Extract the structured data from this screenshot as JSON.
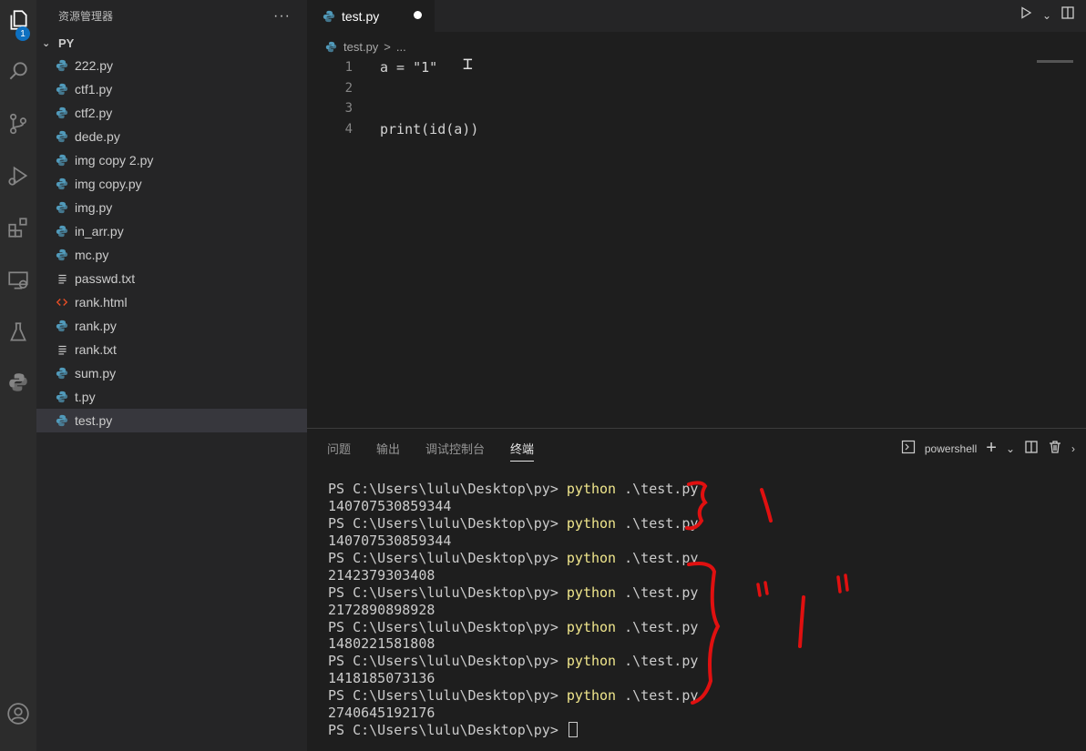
{
  "activity_bar": {
    "explorer_badge": "1",
    "icons": [
      "explorer-icon",
      "search-icon",
      "source-control-icon",
      "run-debug-icon",
      "extensions-icon",
      "remote-explorer-icon",
      "testing-icon",
      "python-icon",
      "account-icon"
    ]
  },
  "sidebar": {
    "title": "资源管理器",
    "more": "···",
    "folder": "PY",
    "files": [
      {
        "name": "222.py",
        "type": "py"
      },
      {
        "name": "ctf1.py",
        "type": "py"
      },
      {
        "name": "ctf2.py",
        "type": "py"
      },
      {
        "name": "dede.py",
        "type": "py"
      },
      {
        "name": "img copy 2.py",
        "type": "py"
      },
      {
        "name": "img copy.py",
        "type": "py"
      },
      {
        "name": "img.py",
        "type": "py"
      },
      {
        "name": "in_arr.py",
        "type": "py"
      },
      {
        "name": "mc.py",
        "type": "py"
      },
      {
        "name": "passwd.txt",
        "type": "txt"
      },
      {
        "name": "rank.html",
        "type": "html"
      },
      {
        "name": "rank.py",
        "type": "py"
      },
      {
        "name": "rank.txt",
        "type": "txt"
      },
      {
        "name": "sum.py",
        "type": "py"
      },
      {
        "name": "t.py",
        "type": "py"
      },
      {
        "name": "test.py",
        "type": "py",
        "active": true
      }
    ]
  },
  "editor": {
    "tab_label": "test.py",
    "breadcrumb_file": "test.py",
    "breadcrumb_sep": ">",
    "breadcrumb_more": "...",
    "lines": [
      {
        "num": "1",
        "text": "a = \"1\""
      },
      {
        "num": "2",
        "text": ""
      },
      {
        "num": "3",
        "text": ""
      },
      {
        "num": "4",
        "text": "print(id(a))"
      }
    ]
  },
  "panel": {
    "tabs": [
      "问题",
      "输出",
      "调试控制台",
      "终端"
    ],
    "active_tab": "终端",
    "shell_label": "powershell"
  },
  "terminal": {
    "prompt": "PS C:\\Users\\lulu\\Desktop\\py> ",
    "command": "python",
    "args": " .\\test.py",
    "runs": [
      "140707530859344",
      "140707530859344",
      "2142379303408",
      "2172890898928",
      "1480221581808",
      "1418185073136",
      "2740645192176"
    ]
  },
  "annotations": {
    "label_one": "1",
    "label_quoted": "\"1\""
  }
}
